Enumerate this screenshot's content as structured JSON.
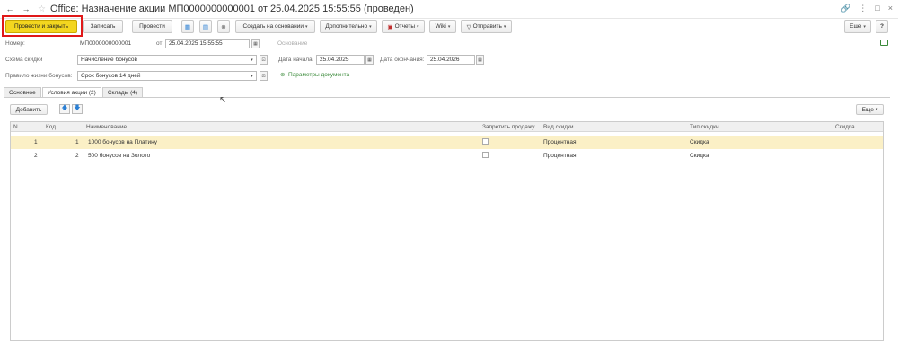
{
  "window": {
    "title": "Office: Назначение акции МП0000000000001 от 25.04.2025 15:55:55 (проведен)",
    "back_glyph": "←",
    "forward_glyph": "→",
    "star_glyph": "☆",
    "link_glyph": "🔗",
    "menu_glyph": "⋮",
    "max_glyph": "□",
    "close_glyph": "×"
  },
  "toolbar": {
    "post_close": "Провести и закрыть",
    "save": "Записать",
    "post": "Провести",
    "create_based": "Создать на основании",
    "additional": "Дополнительно",
    "reports": "Отчеты",
    "wiki": "Wiki",
    "send": "Отправить",
    "more": "Еще",
    "help": "?"
  },
  "form": {
    "number_label": "Номер:",
    "number_value": "МП0000000000001",
    "from_label": "от:",
    "date_value": "25.04.2025 15:55:55",
    "basis_label": "Основание",
    "scheme_label": "Схема скидки",
    "scheme_value": "Начисление бонусов",
    "start_label": "Дата начала:",
    "start_value": "25.04.2025",
    "end_label": "Дата окончания:",
    "end_value": "25.04.2026",
    "rule_label": "Правило жизни бонусов:",
    "rule_value": "Срок бонусов 14 дней",
    "params_link": "Параметры документа"
  },
  "tabs": [
    {
      "label": "Основное",
      "active": false
    },
    {
      "label": "Условия акции (2)",
      "active": true
    },
    {
      "label": "Склады (4)",
      "active": false
    }
  ],
  "table_toolbar": {
    "add": "Добавить",
    "more": "Еще"
  },
  "table": {
    "columns": [
      "N",
      "Код",
      "Наименование",
      "Запретить продажу",
      "Вид скидки",
      "Тип скидки",
      "Скидка"
    ],
    "rows": [
      {
        "n": "1",
        "code": "1",
        "name": "1000 бонусов на Платину",
        "forbid": false,
        "kind": "Процентная",
        "type": "Скидка",
        "discount": "",
        "selected": true
      },
      {
        "n": "2",
        "code": "2",
        "name": "500 бонусов на Золото",
        "forbid": false,
        "kind": "Процентная",
        "type": "Скидка",
        "discount": "",
        "selected": false
      }
    ]
  },
  "colors": {
    "primary_button": "#f3d61f",
    "highlight_box": "#e01818",
    "selected_row": "#fbf0c6",
    "link": "#3a8a3a"
  }
}
